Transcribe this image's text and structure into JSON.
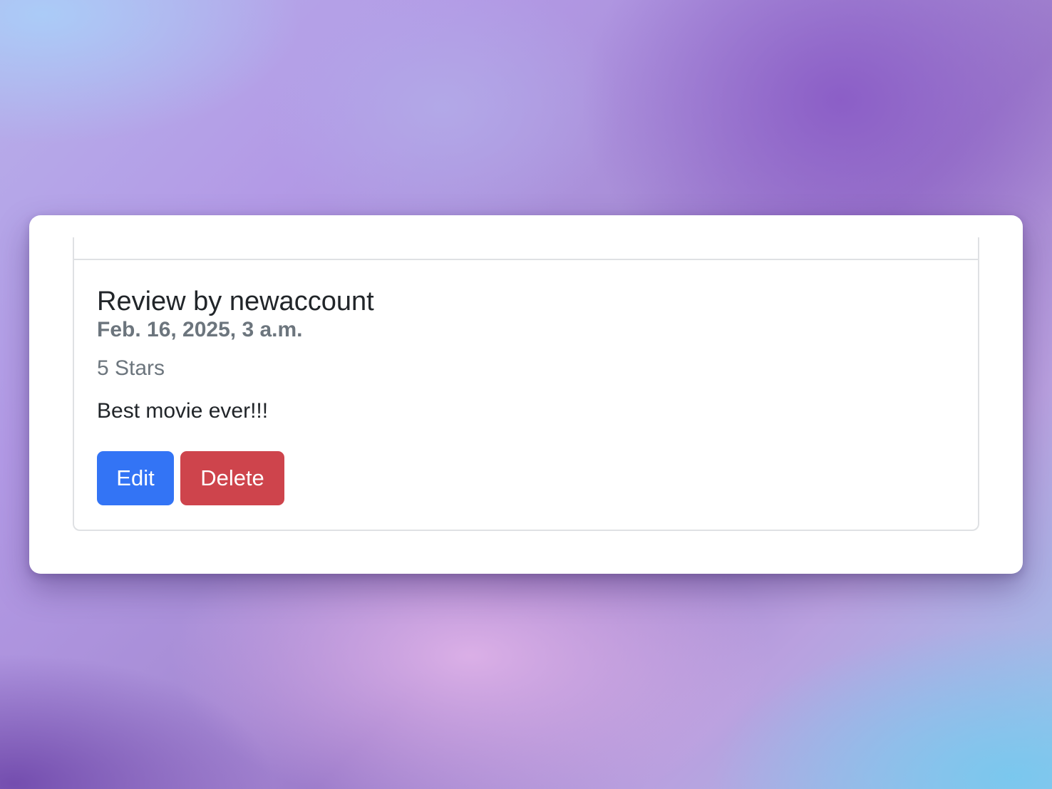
{
  "review": {
    "title": "Review by newaccount",
    "date": "Feb. 16, 2025, 3 a.m.",
    "rating": "5 Stars",
    "text": "Best movie ever!!!"
  },
  "actions": {
    "edit_label": "Edit",
    "delete_label": "Delete"
  },
  "colors": {
    "edit_button": "#3374f5",
    "delete_button": "#ce444c",
    "title_text": "#212529",
    "muted_text": "#6c757d"
  }
}
